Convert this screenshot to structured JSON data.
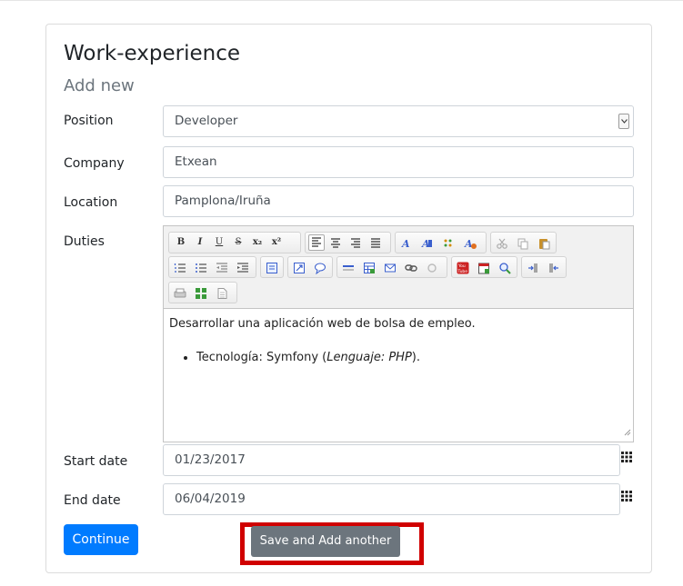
{
  "header": {
    "title": "Work-experience",
    "subtitle": "Add new"
  },
  "form": {
    "position": {
      "label": "Position",
      "value": "Developer"
    },
    "company": {
      "label": "Company",
      "value": "Etxean"
    },
    "location": {
      "label": "Location",
      "value": "Pamplona/Iruña"
    },
    "duties": {
      "label": "Duties",
      "paragraph": "Desarrollar una aplicación web de bolsa de empleo.",
      "bullet_prefix": "Tecnología: Symfony (",
      "bullet_italic": "Lenguaje: PHP",
      "bullet_suffix": ")."
    },
    "start_date": {
      "label": "Start date",
      "value": "01/23/2017"
    },
    "end_date": {
      "label": "End date",
      "value": "06/04/2019"
    }
  },
  "toolbar": {
    "bold": "B",
    "italic": "I",
    "underline": "U",
    "strike": "S",
    "subscript": "x₂",
    "superscript": "x²"
  },
  "actions": {
    "continue_label": "Continue",
    "save_add_label": "Save and Add another"
  },
  "colors": {
    "primary": "#007bff",
    "secondary": "#6c757d",
    "highlight": "#d00000"
  }
}
